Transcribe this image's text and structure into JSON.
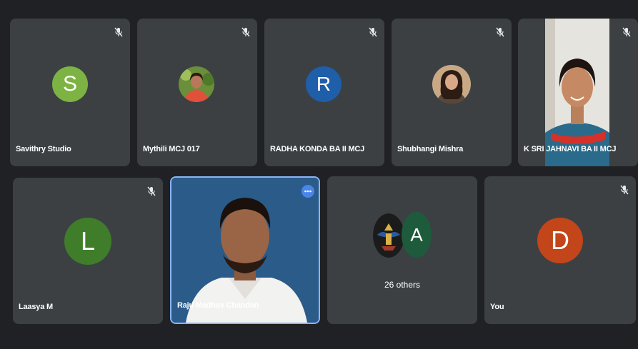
{
  "colors": {
    "background": "#202124",
    "tile": "#3c4043",
    "active_speaker_border": "#8ab4f8"
  },
  "participants": [
    {
      "name": "Savithry Studio",
      "initial": "S",
      "avatar_color": "#7cb342",
      "muted": true
    },
    {
      "name": "Mythili MCJ 017",
      "avatar": "photo",
      "muted": true
    },
    {
      "name": "RADHA KONDA BA II MCJ",
      "initial": "R",
      "avatar_color": "#1f5ea8",
      "muted": true
    },
    {
      "name": "Shubhangi Mishra",
      "avatar": "photo",
      "muted": true
    },
    {
      "name": "K SRI JAHNAVI BA II MCJ",
      "avatar": "video",
      "muted": true
    },
    {
      "name": "Laasya M",
      "initial": "L",
      "avatar_color": "#3f7d2a",
      "muted": true
    },
    {
      "name": "Raju Madhav Chandan",
      "avatar": "video",
      "active_speaker": true
    },
    {
      "name": "You",
      "initial": "D",
      "avatar_color": "#c2461a",
      "muted": true
    }
  ],
  "others_tile": {
    "initial": "A",
    "avatar_color": "#1e5a3c",
    "label": "26 others"
  },
  "icons": {
    "mute": "mic-off-icon",
    "more": "more-options-icon",
    "emblem": "emblem-icon"
  }
}
